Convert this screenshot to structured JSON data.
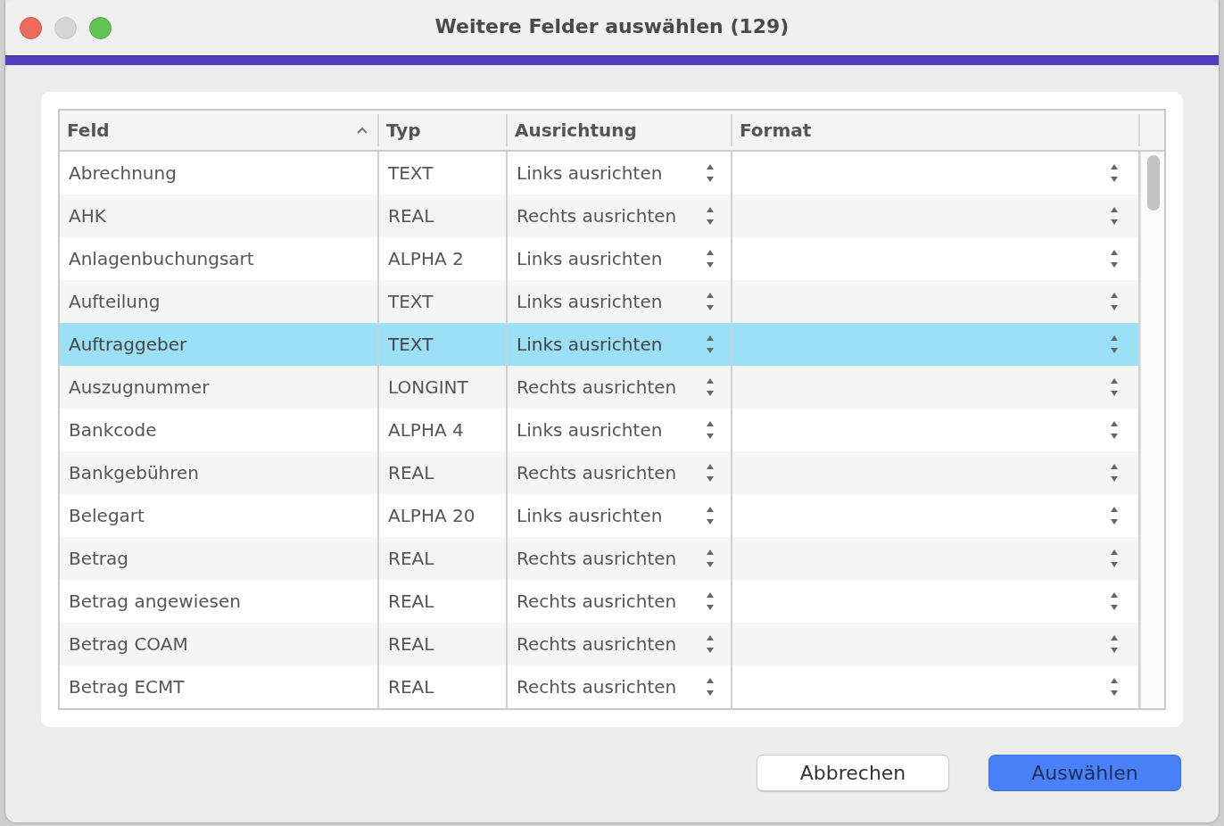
{
  "window": {
    "title": "Weitere Felder auswählen (129)"
  },
  "table": {
    "columns": [
      {
        "label": "Feld",
        "sorted": true
      },
      {
        "label": "Typ",
        "sorted": false
      },
      {
        "label": "Ausrichtung",
        "sorted": false
      },
      {
        "label": "Format",
        "sorted": false
      }
    ],
    "rows": [
      {
        "feld": "Abrechnung",
        "typ": "TEXT",
        "ausrichtung": "Links ausrichten",
        "selected": false
      },
      {
        "feld": "AHK",
        "typ": "REAL",
        "ausrichtung": "Rechts ausrichten",
        "selected": false
      },
      {
        "feld": "Anlagenbuchungsart",
        "typ": "ALPHA 2",
        "ausrichtung": "Links ausrichten",
        "selected": false
      },
      {
        "feld": "Aufteilung",
        "typ": "TEXT",
        "ausrichtung": "Links ausrichten",
        "selected": false
      },
      {
        "feld": "Auftraggeber",
        "typ": "TEXT",
        "ausrichtung": "Links ausrichten",
        "selected": true
      },
      {
        "feld": "Auszugnummer",
        "typ": "LONGINT",
        "ausrichtung": "Rechts ausrichten",
        "selected": false
      },
      {
        "feld": "Bankcode",
        "typ": "ALPHA 4",
        "ausrichtung": "Links ausrichten",
        "selected": false
      },
      {
        "feld": "Bankgebühren",
        "typ": "REAL",
        "ausrichtung": "Rechts ausrichten",
        "selected": false
      },
      {
        "feld": "Belegart",
        "typ": "ALPHA 20",
        "ausrichtung": "Links ausrichten",
        "selected": false
      },
      {
        "feld": "Betrag",
        "typ": "REAL",
        "ausrichtung": "Rechts ausrichten",
        "selected": false
      },
      {
        "feld": "Betrag angewiesen",
        "typ": "REAL",
        "ausrichtung": "Rechts ausrichten",
        "selected": false
      },
      {
        "feld": "Betrag COAM",
        "typ": "REAL",
        "ausrichtung": "Rechts ausrichten",
        "selected": false
      },
      {
        "feld": "Betrag ECMT",
        "typ": "REAL",
        "ausrichtung": "Rechts ausrichten",
        "selected": false
      }
    ]
  },
  "buttons": [
    {
      "label": "Abbrechen",
      "kind": "secondary"
    },
    {
      "label": "Auswählen",
      "kind": "primary"
    }
  ]
}
